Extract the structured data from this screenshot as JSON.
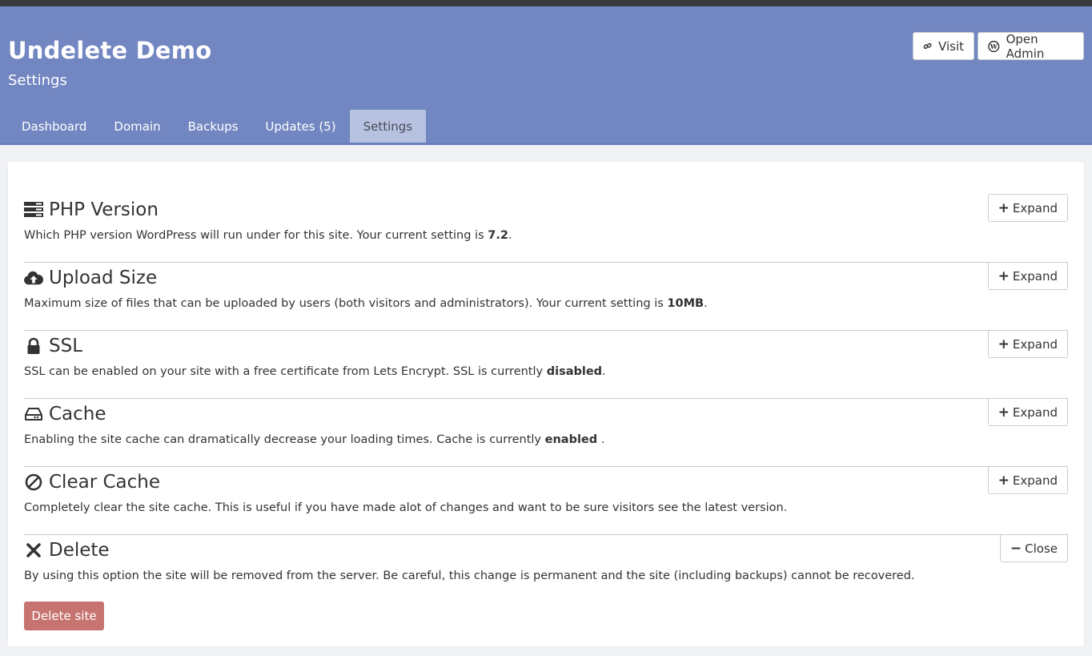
{
  "site": {
    "title": "Undelete Demo",
    "subtitle": "Settings"
  },
  "header_buttons": {
    "visit": "Visit",
    "open_admin": "Open Admin"
  },
  "tabs": [
    "Dashboard",
    "Domain",
    "Backups",
    "Updates (5)",
    "Settings"
  ],
  "active_tab": "Settings",
  "colors": {
    "header": "#7286c1",
    "active_tab": "#b7c1e0",
    "danger": "#c77470"
  },
  "sections": [
    {
      "icon": "server-icon",
      "title": "PHP Version",
      "desc_pre": "Which PHP version WordPress will run under for this site. Your current setting is ",
      "desc_bold": "7.2",
      "desc_post": ".",
      "button": "Expand"
    },
    {
      "icon": "cloud-upload-icon",
      "title": "Upload Size",
      "desc_pre": "Maximum size of files that can be uploaded by users (both visitors and administrators). Your current setting is ",
      "desc_bold": "10MB",
      "desc_post": ".",
      "button": "Expand"
    },
    {
      "icon": "lock-icon",
      "title": "SSL",
      "desc_pre": "SSL can be enabled on your site with a free certificate from Lets Encrypt. SSL is currently ",
      "desc_bold": "disabled",
      "desc_post": ".",
      "button": "Expand"
    },
    {
      "icon": "hard-drive-icon",
      "title": "Cache",
      "desc_pre": "Enabling the site cache can dramatically decrease your loading times. Cache is currently ",
      "desc_bold": "enabled",
      "desc_post": " .",
      "button": "Expand"
    },
    {
      "icon": "ban-icon",
      "title": "Clear Cache",
      "desc_pre": "Completely clear the site cache. This is useful if you have made alot of changes and want to be sure visitors see the latest version.",
      "desc_bold": "",
      "desc_post": "",
      "button": "Expand"
    },
    {
      "icon": "times-icon",
      "title": "Delete",
      "desc_pre": "By using this option the site will be removed from the server. Be careful, this change is permanent and the site (including backups) cannot be recovered.",
      "desc_bold": "",
      "desc_post": "",
      "button": "Close"
    }
  ],
  "delete_button": "Delete site"
}
